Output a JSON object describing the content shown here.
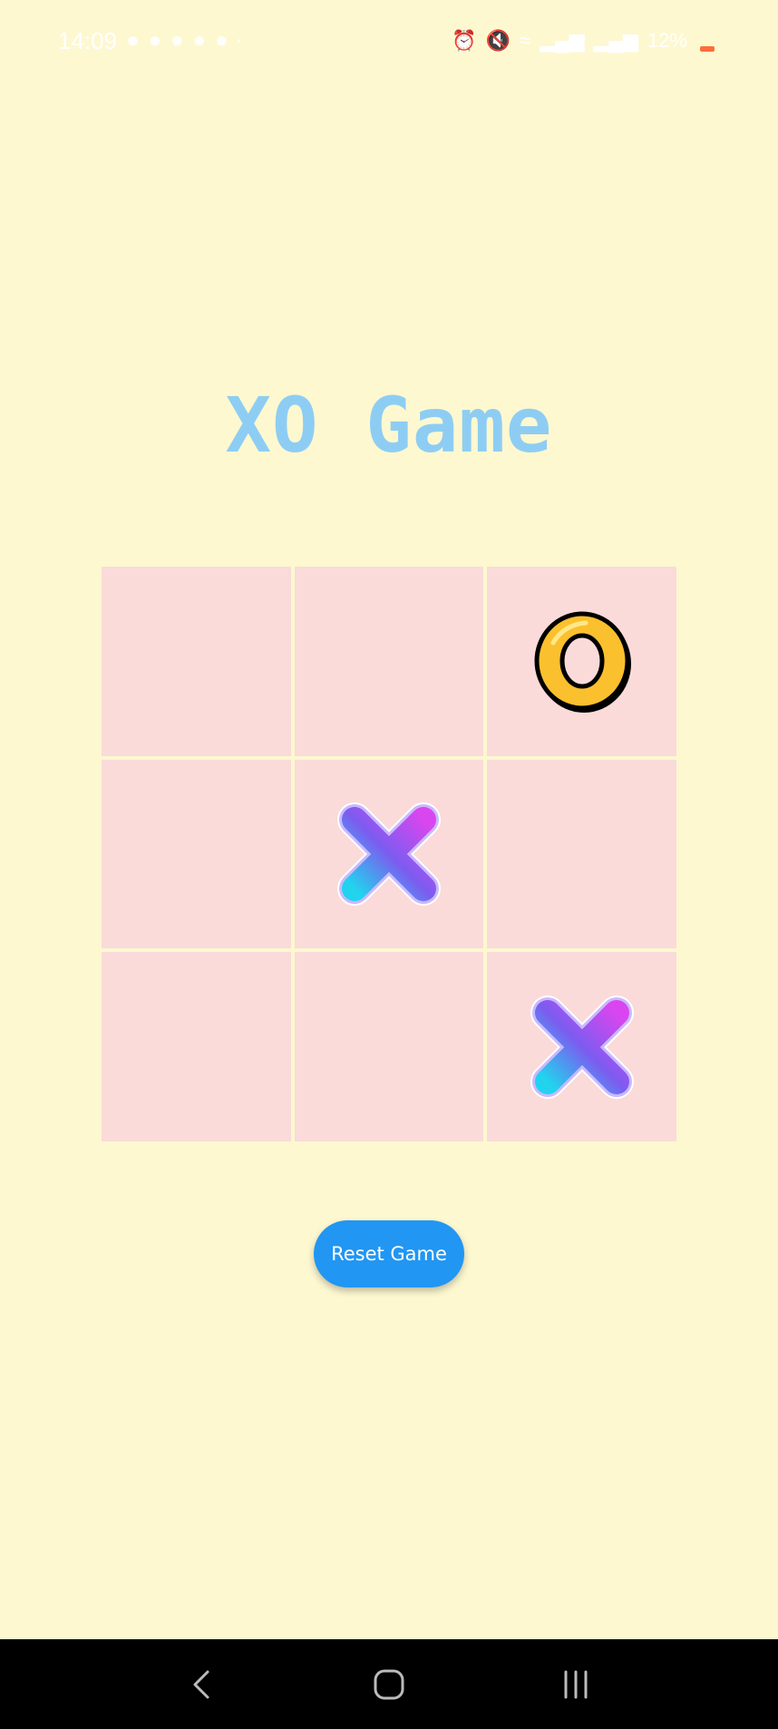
{
  "status_bar": {
    "time": "14:09",
    "battery": "12%",
    "notification_icons": [
      "game-controller-icon",
      "game-controller-icon",
      "game-controller-icon",
      "game-controller-icon",
      "game-controller-icon",
      "dot-icon"
    ],
    "system_icons": [
      "alarm-icon",
      "mute-icon",
      "wifi-icon",
      "signal-icon",
      "signal-icon"
    ]
  },
  "app": {
    "title": "XO Game",
    "reset_label": "Reset Game"
  },
  "board": {
    "cells": [
      "",
      "",
      "O",
      "",
      "X",
      "",
      "",
      "",
      "X"
    ]
  },
  "colors": {
    "background": "#fdf8d0",
    "title": "#8ecdf3",
    "cell": "#fadbd9",
    "button": "#2196f3",
    "o_mark": "#fbc02d",
    "x_gradient_start": "#22d3ee",
    "x_gradient_end": "#d946ef"
  },
  "nav_bar": {
    "buttons": [
      "back-icon",
      "home-icon",
      "recent-apps-icon"
    ]
  }
}
